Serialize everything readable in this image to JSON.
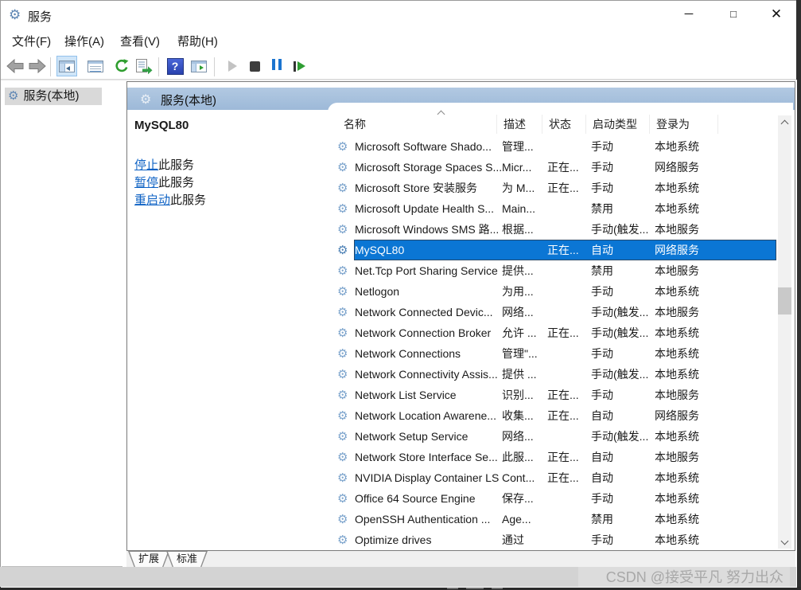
{
  "icons": {
    "gear": "⚙"
  },
  "window": {
    "title": "服务",
    "controls": {
      "minimize": "─",
      "maximize": "□",
      "close": "✕"
    }
  },
  "menu": {
    "items": [
      "文件(F)",
      "操作(A)",
      "查看(V)",
      "帮助(H)"
    ]
  },
  "toolbar": {
    "icons": [
      "back",
      "forward",
      "show-console-tree",
      "properties",
      "refresh",
      "export-list",
      "help",
      "show-action-pane",
      "start-service",
      "stop-service",
      "pause-service",
      "restart-service"
    ],
    "help_glyph": "?"
  },
  "tree": {
    "root": "服务(本地)"
  },
  "main": {
    "header": "服务(本地)",
    "info": {
      "service_name": "MySQL80",
      "links": [
        {
          "action": "停止",
          "suffix": "此服务"
        },
        {
          "action": "暂停",
          "suffix": "此服务"
        },
        {
          "action": "重启动",
          "suffix": "此服务"
        }
      ]
    },
    "table": {
      "columns": [
        "名称",
        "描述",
        "状态",
        "启动类型",
        "登录为"
      ],
      "rows": [
        {
          "name": "Microsoft Software Shado...",
          "desc": "管理...",
          "status": "",
          "startup": "手动",
          "logon": "本地系统",
          "selected": false
        },
        {
          "name": "Microsoft Storage Spaces S...",
          "desc": "Micr...",
          "status": "正在...",
          "startup": "手动",
          "logon": "网络服务",
          "selected": false
        },
        {
          "name": "Microsoft Store 安装服务",
          "desc": "为 M...",
          "status": "正在...",
          "startup": "手动",
          "logon": "本地系统",
          "selected": false
        },
        {
          "name": "Microsoft Update Health S...",
          "desc": "Main...",
          "status": "",
          "startup": "禁用",
          "logon": "本地系统",
          "selected": false
        },
        {
          "name": "Microsoft Windows SMS 路...",
          "desc": "根据...",
          "status": "",
          "startup": "手动(触发...",
          "logon": "本地服务",
          "selected": false
        },
        {
          "name": "MySQL80",
          "desc": "",
          "status": "正在...",
          "startup": "自动",
          "logon": "网络服务",
          "selected": true
        },
        {
          "name": "Net.Tcp Port Sharing Service",
          "desc": "提供...",
          "status": "",
          "startup": "禁用",
          "logon": "本地服务",
          "selected": false
        },
        {
          "name": "Netlogon",
          "desc": "为用...",
          "status": "",
          "startup": "手动",
          "logon": "本地系统",
          "selected": false
        },
        {
          "name": "Network Connected Devic...",
          "desc": "网络...",
          "status": "",
          "startup": "手动(触发...",
          "logon": "本地服务",
          "selected": false
        },
        {
          "name": "Network Connection Broker",
          "desc": "允许 ...",
          "status": "正在...",
          "startup": "手动(触发...",
          "logon": "本地系统",
          "selected": false
        },
        {
          "name": "Network Connections",
          "desc": "管理\"...",
          "status": "",
          "startup": "手动",
          "logon": "本地系统",
          "selected": false
        },
        {
          "name": "Network Connectivity Assis...",
          "desc": "提供 ...",
          "status": "",
          "startup": "手动(触发...",
          "logon": "本地系统",
          "selected": false
        },
        {
          "name": "Network List Service",
          "desc": "识别...",
          "status": "正在...",
          "startup": "手动",
          "logon": "本地服务",
          "selected": false
        },
        {
          "name": "Network Location Awarene...",
          "desc": "收集...",
          "status": "正在...",
          "startup": "自动",
          "logon": "网络服务",
          "selected": false
        },
        {
          "name": "Network Setup Service",
          "desc": "网络...",
          "status": "",
          "startup": "手动(触发...",
          "logon": "本地系统",
          "selected": false
        },
        {
          "name": "Network Store Interface Se...",
          "desc": "此服...",
          "status": "正在...",
          "startup": "自动",
          "logon": "本地服务",
          "selected": false
        },
        {
          "name": "NVIDIA Display Container LS",
          "desc": "Cont...",
          "status": "正在...",
          "startup": "自动",
          "logon": "本地系统",
          "selected": false
        },
        {
          "name": "Office 64 Source Engine",
          "desc": "保存...",
          "status": "",
          "startup": "手动",
          "logon": "本地系统",
          "selected": false
        },
        {
          "name": "OpenSSH Authentication ...",
          "desc": "Age...",
          "status": "",
          "startup": "禁用",
          "logon": "本地系统",
          "selected": false
        },
        {
          "name": "Optimize drives",
          "desc": "通过",
          "status": "",
          "startup": "手动",
          "logon": "本地系统",
          "selected": false
        }
      ]
    }
  },
  "tabs": {
    "items": [
      "扩展",
      "标准"
    ],
    "active": "扩展"
  },
  "watermark": "CSDN @接受平凡 努力出众",
  "colors": {
    "selection": "#0b76d4",
    "header_band": "#a6c0dc",
    "link": "#0e62c4",
    "tree_selection": "#d9d9d9",
    "watermark_text": "#a8a8a8"
  }
}
